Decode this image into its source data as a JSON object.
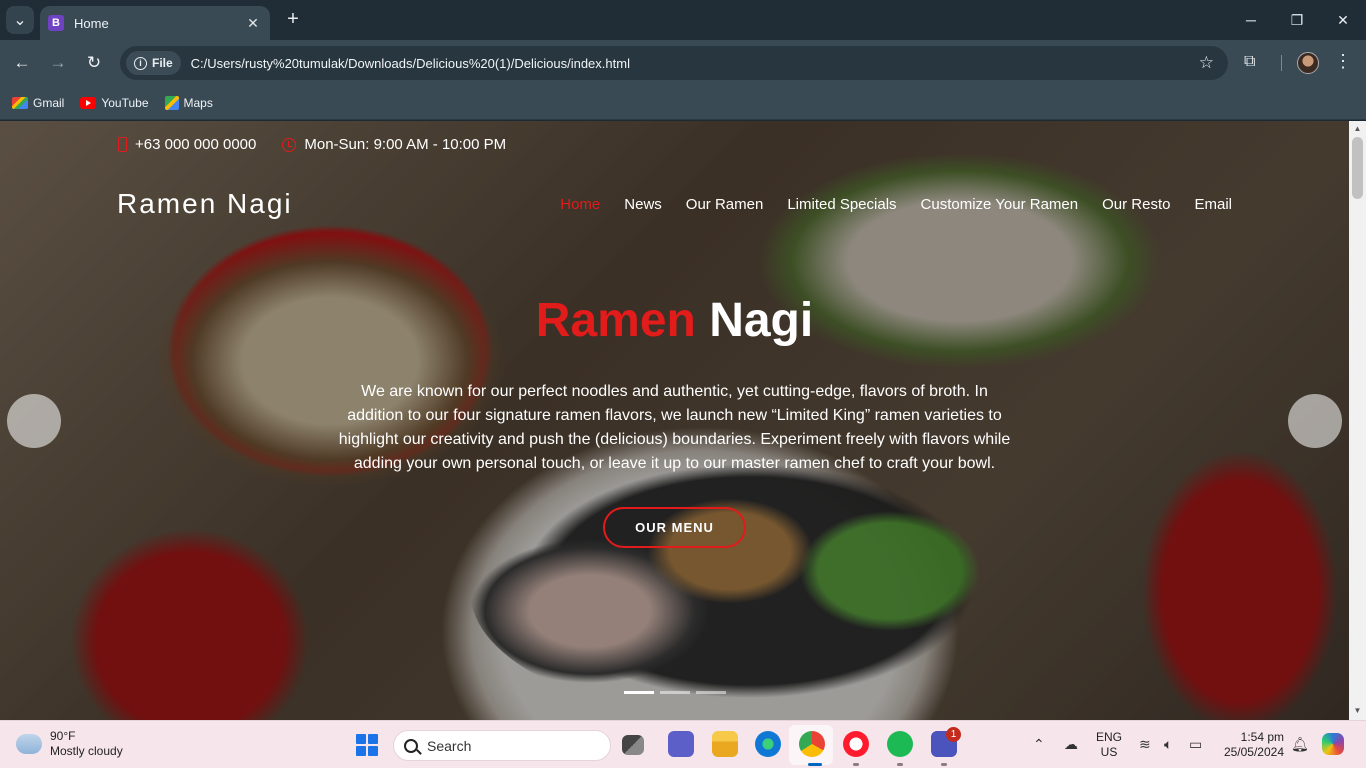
{
  "browser": {
    "tab_title": "Home",
    "tab_favicon_letter": "B",
    "file_chip": "File",
    "url": "C:/Users/rusty%20tumulak/Downloads/Delicious%20(1)/Delicious/index.html",
    "bookmarks": [
      {
        "label": "Gmail",
        "icon": "gmail-icon"
      },
      {
        "label": "YouTube",
        "icon": "youtube-icon"
      },
      {
        "label": "Maps",
        "icon": "maps-icon"
      }
    ]
  },
  "site": {
    "phone": "+63 000 000 0000",
    "hours": "Mon-Sun: 9:00 AM - 10:00 PM",
    "logo": "Ramen Nagi",
    "nav": [
      {
        "label": "Home",
        "active": true
      },
      {
        "label": "News"
      },
      {
        "label": "Our Ramen"
      },
      {
        "label": "Limited Specials"
      },
      {
        "label": "Customize Your Ramen"
      },
      {
        "label": "Our Resto"
      },
      {
        "label": "Email"
      }
    ],
    "hero": {
      "title_accent": "Ramen",
      "title_rest": "Nagi",
      "text": "We are known for our perfect noodles and authentic, yet cutting-edge, flavors of broth. In addition to our four signature ramen flavors, we launch new “Limited King” ramen varieties to highlight our creativity and push the (delicious) boundaries. Experiment freely with flavors while adding your own personal touch, or leave it up to our master ramen chef to craft your bowl.",
      "button": "OUR MENU",
      "slides": 3,
      "active_slide": 1
    },
    "accent_color": "#e21b1b"
  },
  "taskbar": {
    "weather_temp": "90°F",
    "weather_desc": "Mostly cloudy",
    "search_placeholder": "Search",
    "teams_badge": "1",
    "lang_1": "ENG",
    "lang_2": "US",
    "time": "1:54 pm",
    "date": "25/05/2024"
  }
}
